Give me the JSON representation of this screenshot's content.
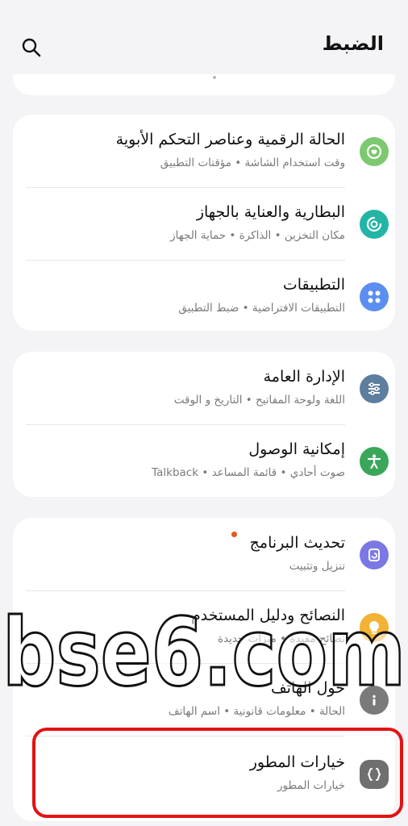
{
  "header": {
    "title": "الضبط"
  },
  "groups": [
    {
      "items": [
        {
          "label": "الحالة الرقمية وعناصر التحكم الأبوية",
          "sub": "وقت استخدام الشاشة  •  مؤقتات التطبيق",
          "icon": "digital-wellbeing-icon",
          "color": "#7cc96f"
        },
        {
          "label": "البطارية والعناية بالجهاز",
          "sub": "مكان التخزين  •  الذاكرة  •  حماية الجهاز",
          "icon": "device-care-icon",
          "color": "#22b5a5"
        },
        {
          "label": "التطبيقات",
          "sub": "التطبيقات الافتراضية  •  ضبط التطبيق",
          "icon": "apps-icon",
          "color": "#5b8ef0"
        }
      ]
    },
    {
      "items": [
        {
          "label": "الإدارة العامة",
          "sub": "اللغة ولوحة المفاتيح  •  التاريخ و الوقت",
          "icon": "general-management-icon",
          "color": "#5d7e9e"
        },
        {
          "label": "إمكانية الوصول",
          "sub": "صوت أحادي  •  قائمة المساعد  •  Talkback",
          "icon": "accessibility-icon",
          "color": "#3aa65a"
        }
      ]
    },
    {
      "items": [
        {
          "label": "تحديث البرنامج",
          "sub": "تنزيل وتثبيت",
          "icon": "software-update-icon",
          "color": "#7b78e6"
        },
        {
          "label": "النصائح ودليل المستخدم",
          "sub": "نصائح مفيدة  •  ميزات جديدة",
          "icon": "tips-icon",
          "color": "#f2b233"
        },
        {
          "label": "حول الهاتف",
          "sub": "الحالة  •  معلومات قانونية  •  اسم الهاتف",
          "icon": "about-phone-icon",
          "color": "#7a7a7a"
        },
        {
          "label": "خيارات المطور",
          "sub": "خيارات المطور",
          "icon": "developer-options-icon",
          "color": "#6f6f6f"
        }
      ]
    }
  ],
  "watermark": {
    "text": "bse6.com"
  }
}
